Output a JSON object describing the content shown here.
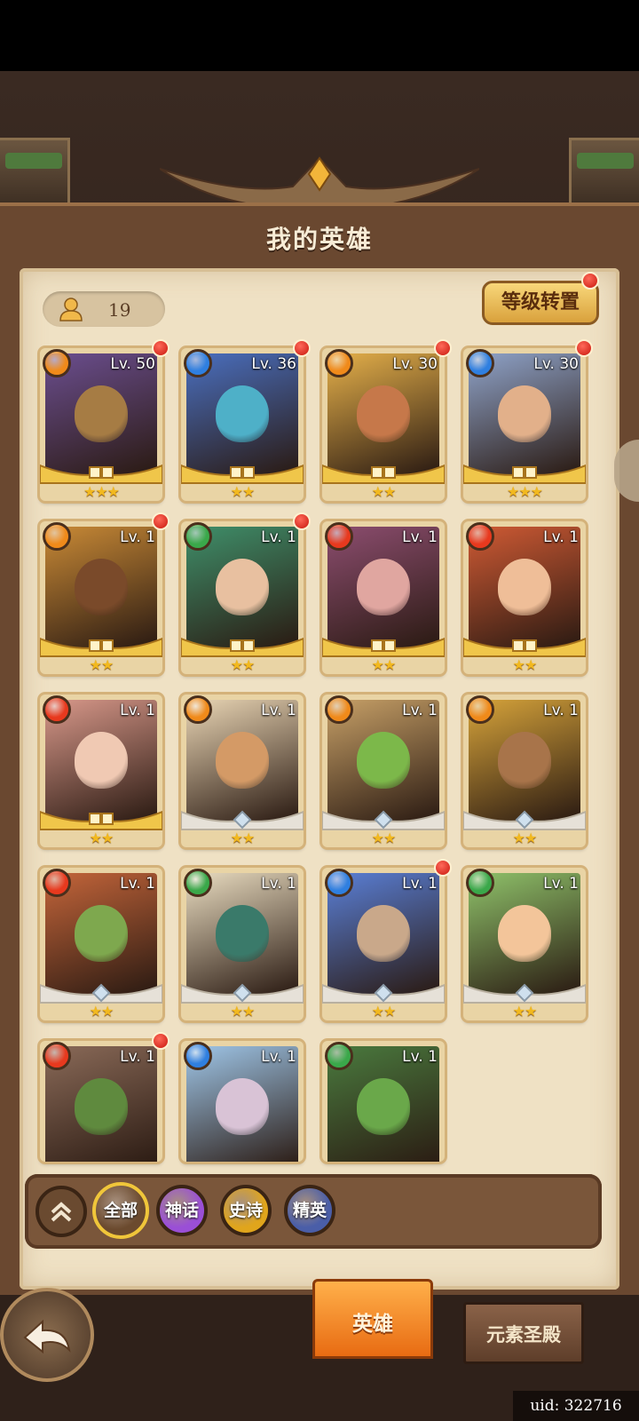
{
  "screen": {
    "title": "我的英雄",
    "uid_label": "uid: 322716"
  },
  "header": {
    "hero_count": "19",
    "level_transfer_button": "等级转置"
  },
  "elements": {
    "fire": "#e8391e",
    "water": "#2f7fe0",
    "wood": "#3aa84a",
    "light": "#f08a1a"
  },
  "heroes": [
    {
      "level": "Lv. 50",
      "stars": "★★★",
      "element": "light",
      "dot": true,
      "portrait": "#6b4e8f",
      "skin": "#a67c44"
    },
    {
      "level": "Lv. 36",
      "stars": "★★",
      "element": "water",
      "dot": true,
      "portrait": "#4a6fbf",
      "skin": "#4eb0c8"
    },
    {
      "level": "Lv. 30",
      "stars": "★★",
      "element": "light",
      "dot": true,
      "portrait": "#e5b04a",
      "skin": "#c6784a"
    },
    {
      "level": "Lv. 30",
      "stars": "★★★",
      "element": "water",
      "dot": true,
      "portrait": "#8fa3c9",
      "skin": "#e2b08a"
    },
    {
      "level": "Lv. 1",
      "stars": "★★",
      "element": "light",
      "dot": true,
      "portrait": "#c98a36",
      "skin": "#7a4a2a"
    },
    {
      "level": "Lv. 1",
      "stars": "★★",
      "element": "wood",
      "dot": true,
      "portrait": "#3f8f6a",
      "skin": "#e8c0a0"
    },
    {
      "level": "Lv. 1",
      "stars": "★★",
      "element": "fire",
      "dot": false,
      "portrait": "#8c4d6f",
      "skin": "#e0a6a0"
    },
    {
      "level": "Lv. 1",
      "stars": "★★",
      "element": "fire",
      "dot": false,
      "portrait": "#cf5a34",
      "skin": "#efbe98"
    },
    {
      "level": "Lv. 1",
      "stars": "★★",
      "element": "fire",
      "dot": false,
      "portrait": "#d8988a",
      "skin": "#f0c9b3"
    },
    {
      "level": "Lv. 1",
      "stars": "★★",
      "element": "light",
      "dot": false,
      "portrait": "#e9d5b4",
      "skin": "#d49a66"
    },
    {
      "level": "Lv. 1",
      "stars": "★★",
      "element": "light",
      "dot": false,
      "portrait": "#c7a067",
      "skin": "#7cb84a"
    },
    {
      "level": "Lv. 1",
      "stars": "★★",
      "element": "light",
      "dot": false,
      "portrait": "#d6a33a",
      "skin": "#a8744a"
    },
    {
      "level": "Lv. 1",
      "stars": "★★",
      "element": "fire",
      "dot": false,
      "portrait": "#c4653a",
      "skin": "#7ea84e"
    },
    {
      "level": "Lv. 1",
      "stars": "★★",
      "element": "wood",
      "dot": false,
      "portrait": "#e9dcc0",
      "skin": "#3a7a6a"
    },
    {
      "level": "Lv. 1",
      "stars": "★★",
      "element": "water",
      "dot": true,
      "portrait": "#5a7fd6",
      "skin": "#c9a88a"
    },
    {
      "level": "Lv. 1",
      "stars": "★★",
      "element": "wood",
      "dot": false,
      "portrait": "#8fc26a",
      "skin": "#f3c59a"
    },
    {
      "level": "Lv. 1",
      "stars": "",
      "element": "fire",
      "dot": true,
      "portrait": "#8a6a58",
      "skin": "#5f8a3e"
    },
    {
      "level": "Lv. 1",
      "stars": "",
      "element": "water",
      "dot": false,
      "portrait": "#9fc6e8",
      "skin": "#d9c3d6"
    },
    {
      "level": "Lv. 1",
      "stars": "",
      "element": "wood",
      "dot": false,
      "portrait": "#4a7a3e",
      "skin": "#6aa84a"
    }
  ],
  "filters": [
    {
      "label": "全部",
      "color": "#6b4a2e",
      "ring": "#f0c63a",
      "active": true
    },
    {
      "label": "神话",
      "color": "#9a4fd6",
      "ring": "#3a2414",
      "active": false
    },
    {
      "label": "史诗",
      "color": "#e0a51c",
      "ring": "#3a2414",
      "active": false
    },
    {
      "label": "精英",
      "color": "#4a5ea8",
      "ring": "#3a2414",
      "active": false
    }
  ],
  "tabs": {
    "heroes": "英雄",
    "elemental_temple": "元素圣殿"
  }
}
